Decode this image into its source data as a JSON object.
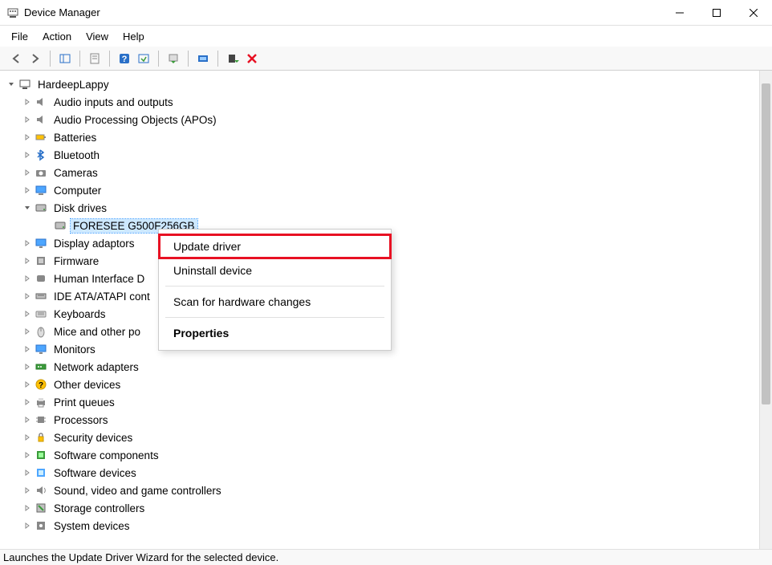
{
  "window": {
    "title": "Device Manager"
  },
  "menu": {
    "items": [
      "File",
      "Action",
      "View",
      "Help"
    ]
  },
  "toolbar": {
    "buttons": [
      {
        "name": "back-icon"
      },
      {
        "name": "forward-icon"
      },
      {
        "name": "show-hide-console-tree-icon"
      },
      {
        "name": "properties-icon"
      },
      {
        "name": "help-icon"
      },
      {
        "name": "scan-hardware-icon"
      },
      {
        "name": "update-driver-icon"
      },
      {
        "name": "uninstall-device-icon"
      },
      {
        "name": "enable-device-icon"
      },
      {
        "name": "disable-device-icon"
      }
    ]
  },
  "tree": {
    "root": {
      "label": "HardeepLappy",
      "expanded": true
    },
    "children": [
      {
        "label": "Audio inputs and outputs",
        "icon": "audio-icon"
      },
      {
        "label": "Audio Processing Objects (APOs)",
        "icon": "audio-icon"
      },
      {
        "label": "Batteries",
        "icon": "battery-icon"
      },
      {
        "label": "Bluetooth",
        "icon": "bluetooth-icon"
      },
      {
        "label": "Cameras",
        "icon": "camera-icon"
      },
      {
        "label": "Computer",
        "icon": "computer-icon"
      },
      {
        "label": "Disk drives",
        "icon": "disk-icon",
        "expanded": true,
        "children": [
          {
            "label": "FORESEE G500F256GB",
            "icon": "disk-icon",
            "selected": true
          }
        ]
      },
      {
        "label": "Display adaptors",
        "icon": "display-icon"
      },
      {
        "label": "Firmware",
        "icon": "firmware-icon"
      },
      {
        "label": "Human Interface Devices",
        "icon": "hid-icon",
        "truncated": "Human Interface D"
      },
      {
        "label": "IDE ATA/ATAPI controllers",
        "icon": "ide-icon",
        "truncated": "IDE ATA/ATAPI cont"
      },
      {
        "label": "Keyboards",
        "icon": "keyboard-icon"
      },
      {
        "label": "Mice and other pointing devices",
        "icon": "mouse-icon",
        "truncated": "Mice and other po"
      },
      {
        "label": "Monitors",
        "icon": "monitor-icon"
      },
      {
        "label": "Network adapters",
        "icon": "network-icon"
      },
      {
        "label": "Other devices",
        "icon": "other-icon"
      },
      {
        "label": "Print queues",
        "icon": "printer-icon"
      },
      {
        "label": "Processors",
        "icon": "processor-icon"
      },
      {
        "label": "Security devices",
        "icon": "security-icon"
      },
      {
        "label": "Software components",
        "icon": "software-comp-icon"
      },
      {
        "label": "Software devices",
        "icon": "software-dev-icon"
      },
      {
        "label": "Sound, video and game controllers",
        "icon": "sound-icon"
      },
      {
        "label": "Storage controllers",
        "icon": "storage-icon"
      },
      {
        "label": "System devices",
        "icon": "system-icon",
        "truncated": "System devices"
      }
    ]
  },
  "contextMenu": {
    "items": [
      {
        "label": "Update driver",
        "highlighted": true
      },
      {
        "label": "Uninstall device"
      },
      {
        "sep": true
      },
      {
        "label": "Scan for hardware changes"
      },
      {
        "sep": true
      },
      {
        "label": "Properties",
        "bold": true
      }
    ]
  },
  "statusbar": {
    "text": "Launches the Update Driver Wizard for the selected device."
  }
}
